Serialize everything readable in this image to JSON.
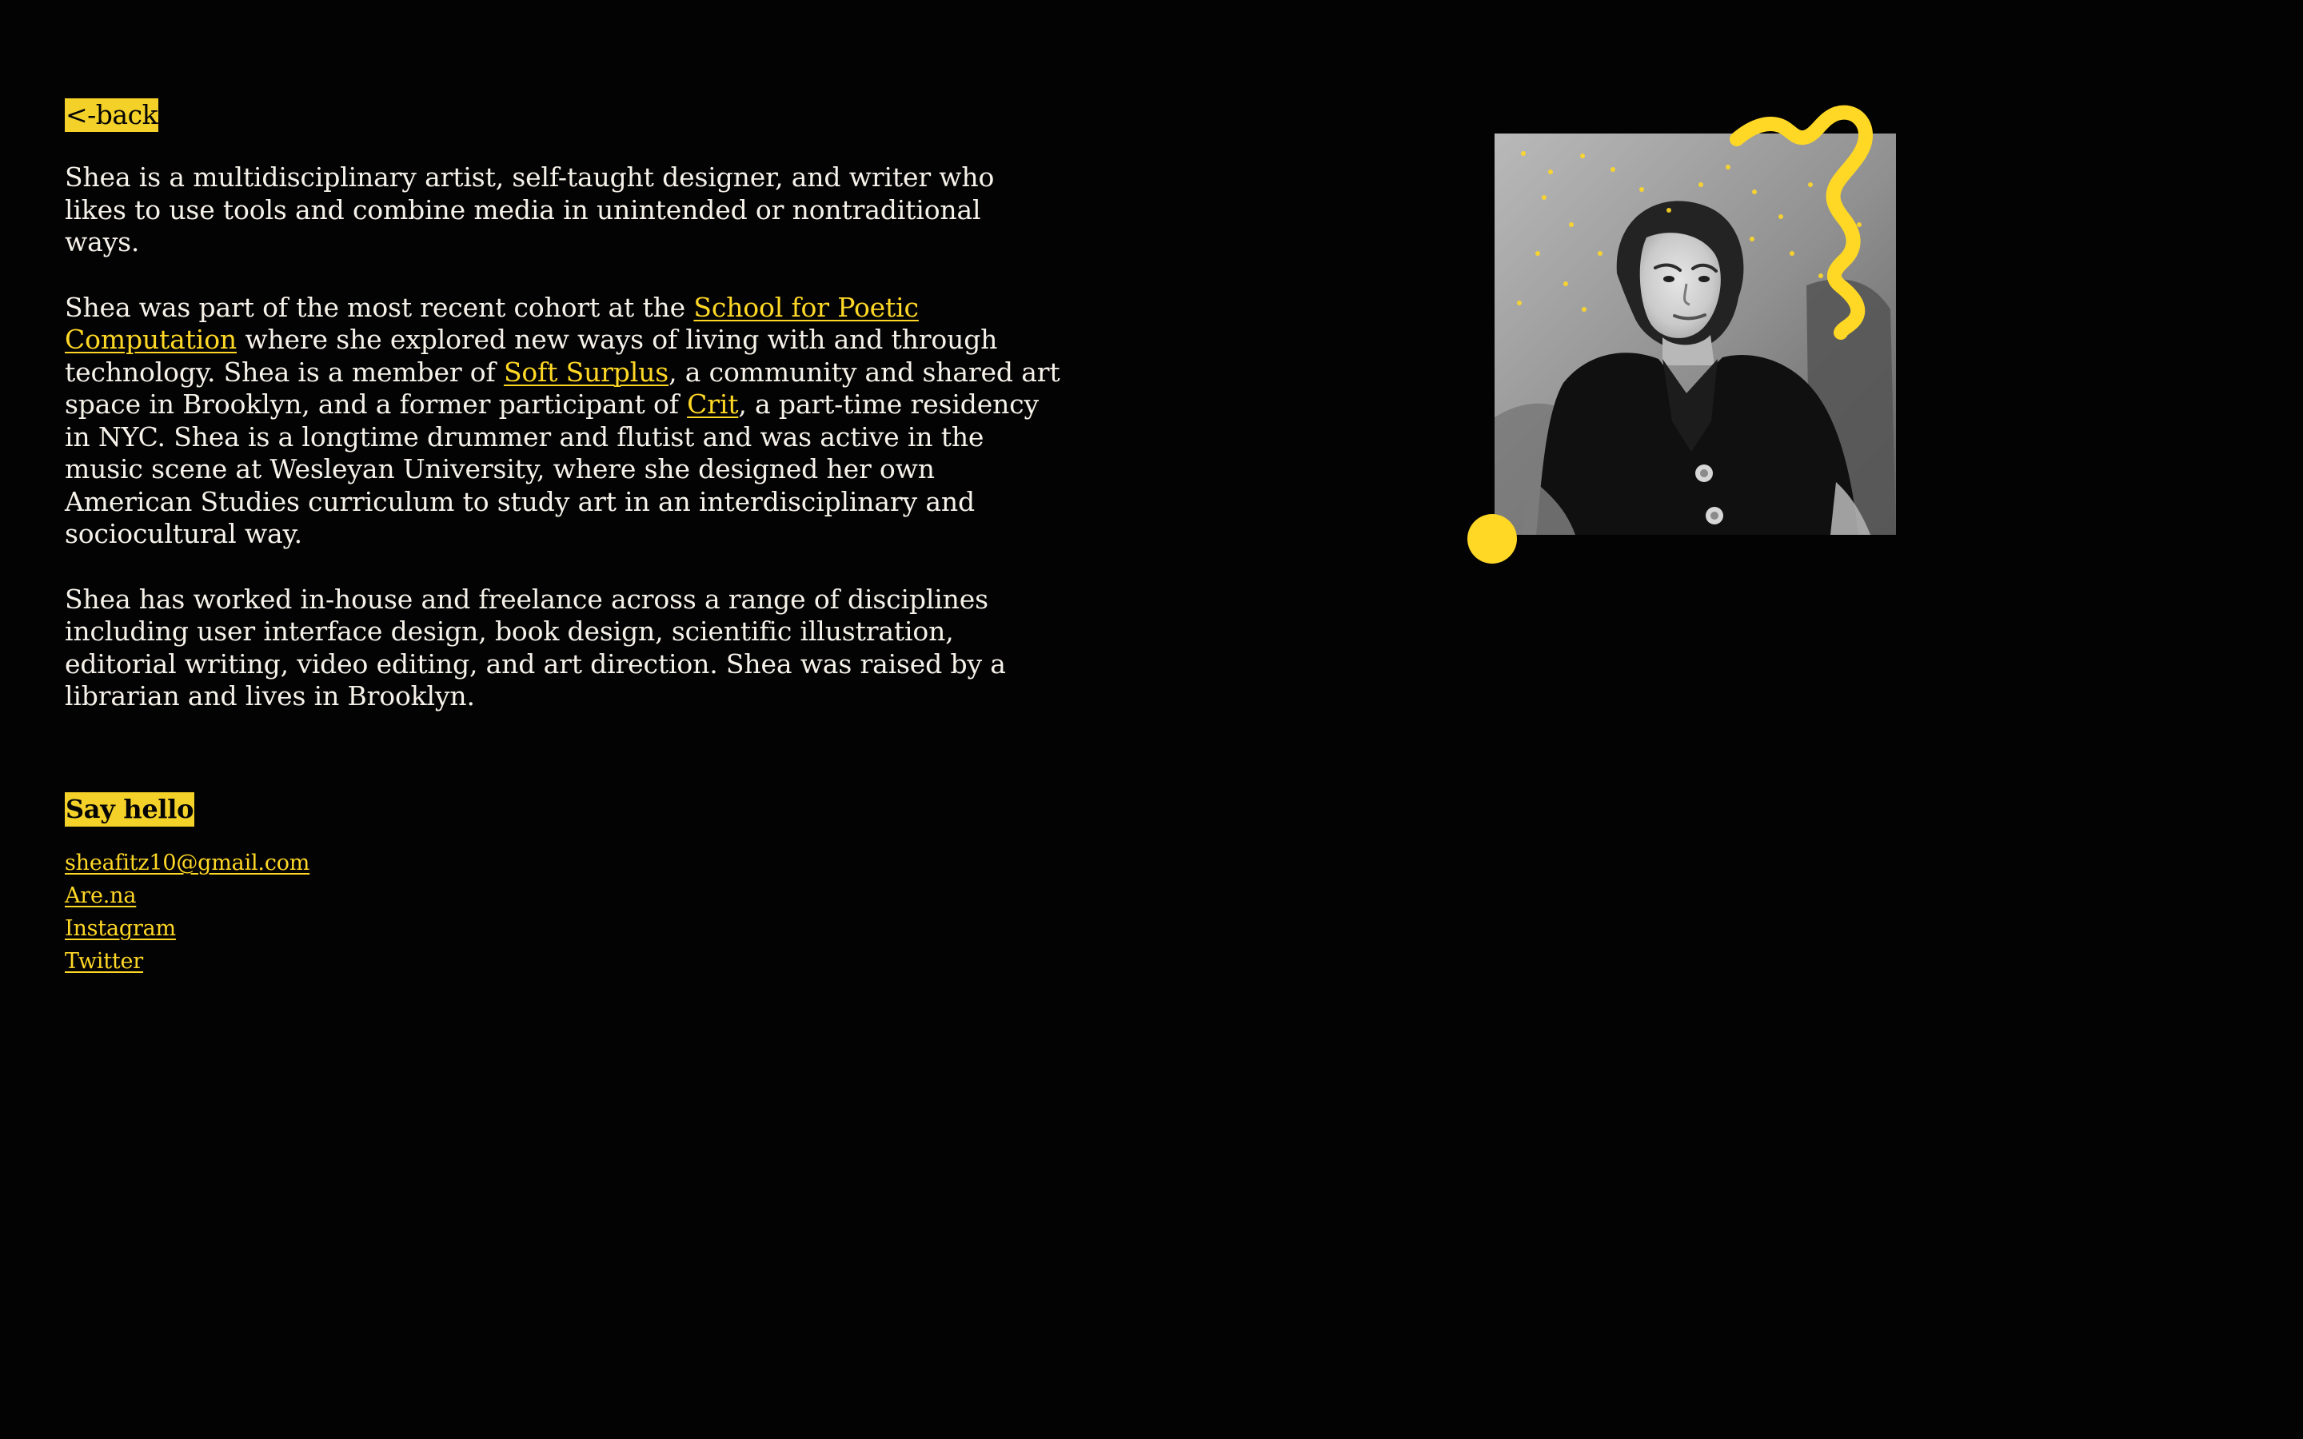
{
  "nav": {
    "back_label": "<-back"
  },
  "bio": {
    "p1": "Shea is a multidisciplinary artist, self-taught designer, and writer who likes to use tools and combine media in unintended or nontraditional ways.",
    "p2_before_link1": "Shea was part of the most recent cohort at the ",
    "link1": "School for Poetic Computation",
    "p2_between_1_2": " where she explored new ways of living with and through technology. Shea is a member of ",
    "link2": "Soft Surplus",
    "p2_between_2_3": ", a community and shared art space in Brooklyn, and a former participant of ",
    "link3": "Crit",
    "p2_after_link3": ", a part-time residency in NYC. Shea is a longtime drummer and flutist and was active in the music scene at Wesleyan University, where she designed her own American Studies curriculum to study art in an interdisciplinary and sociocultural way.",
    "p3": "Shea has worked in-house and freelance across a range of disciplines including user interface design, book design, scientific illustration, editorial writing, video editing, and art direction. Shea was raised by a librarian and lives in Brooklyn."
  },
  "contact": {
    "heading": "Say hello",
    "links": [
      "sheafitz10@gmail.com",
      "Are.na",
      "Instagram",
      "Twitter"
    ]
  },
  "portrait": {
    "image": "portrait-photo",
    "accent_decoration": "squiggle-and-dot"
  },
  "colors": {
    "background": "#030303",
    "text": "#f6f2ea",
    "accent": "#ffd826"
  }
}
